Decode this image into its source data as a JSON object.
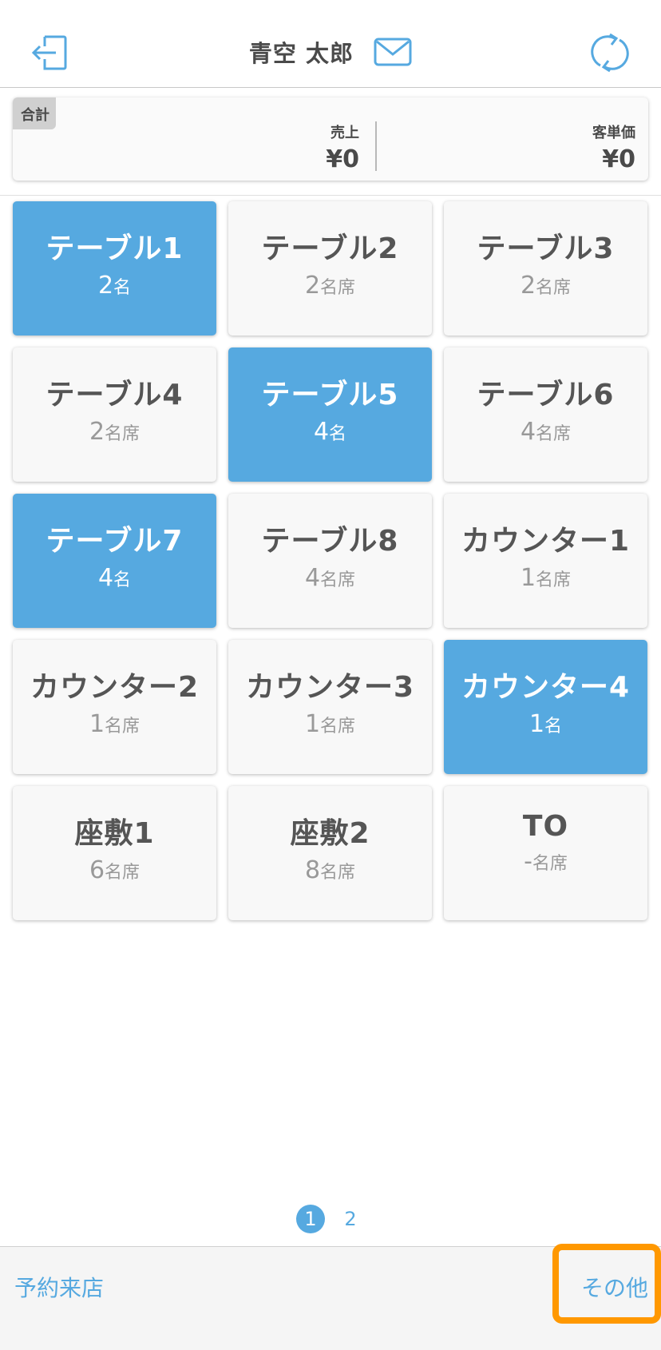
{
  "header": {
    "user_name": "青空 太郎"
  },
  "summary": {
    "badge": "合計",
    "sales_label": "売上",
    "sales_value": "¥0",
    "unit_price_label": "客単価",
    "unit_price_value": "¥0"
  },
  "tables": [
    {
      "name": "テーブル1",
      "count": "2",
      "unit": "名",
      "active": true
    },
    {
      "name": "テーブル2",
      "count": "2",
      "unit": "名席",
      "active": false
    },
    {
      "name": "テーブル3",
      "count": "2",
      "unit": "名席",
      "active": false
    },
    {
      "name": "テーブル4",
      "count": "2",
      "unit": "名席",
      "active": false
    },
    {
      "name": "テーブル5",
      "count": "4",
      "unit": "名",
      "active": true
    },
    {
      "name": "テーブル6",
      "count": "4",
      "unit": "名席",
      "active": false
    },
    {
      "name": "テーブル7",
      "count": "4",
      "unit": "名",
      "active": true
    },
    {
      "name": "テーブル8",
      "count": "4",
      "unit": "名席",
      "active": false
    },
    {
      "name": "カウンター1",
      "count": "1",
      "unit": "名席",
      "active": false
    },
    {
      "name": "カウンター2",
      "count": "1",
      "unit": "名席",
      "active": false
    },
    {
      "name": "カウンター3",
      "count": "1",
      "unit": "名席",
      "active": false
    },
    {
      "name": "カウンター4",
      "count": "1",
      "unit": "名",
      "active": true
    },
    {
      "name": "座敷1",
      "count": "6",
      "unit": "名席",
      "active": false
    },
    {
      "name": "座敷2",
      "count": "8",
      "unit": "名席",
      "active": false
    },
    {
      "name": "TO",
      "count": "-",
      "unit": "名席",
      "active": false
    }
  ],
  "pagination": {
    "pages": [
      "1",
      "2"
    ],
    "current": "1"
  },
  "footer": {
    "left_label": "予約来店",
    "right_label": "その他"
  },
  "colors": {
    "accent": "#56a9e0",
    "highlight": "#ff9800"
  },
  "icons": {
    "logout": "logout-icon",
    "mail": "mail-icon",
    "refresh": "refresh-icon"
  }
}
